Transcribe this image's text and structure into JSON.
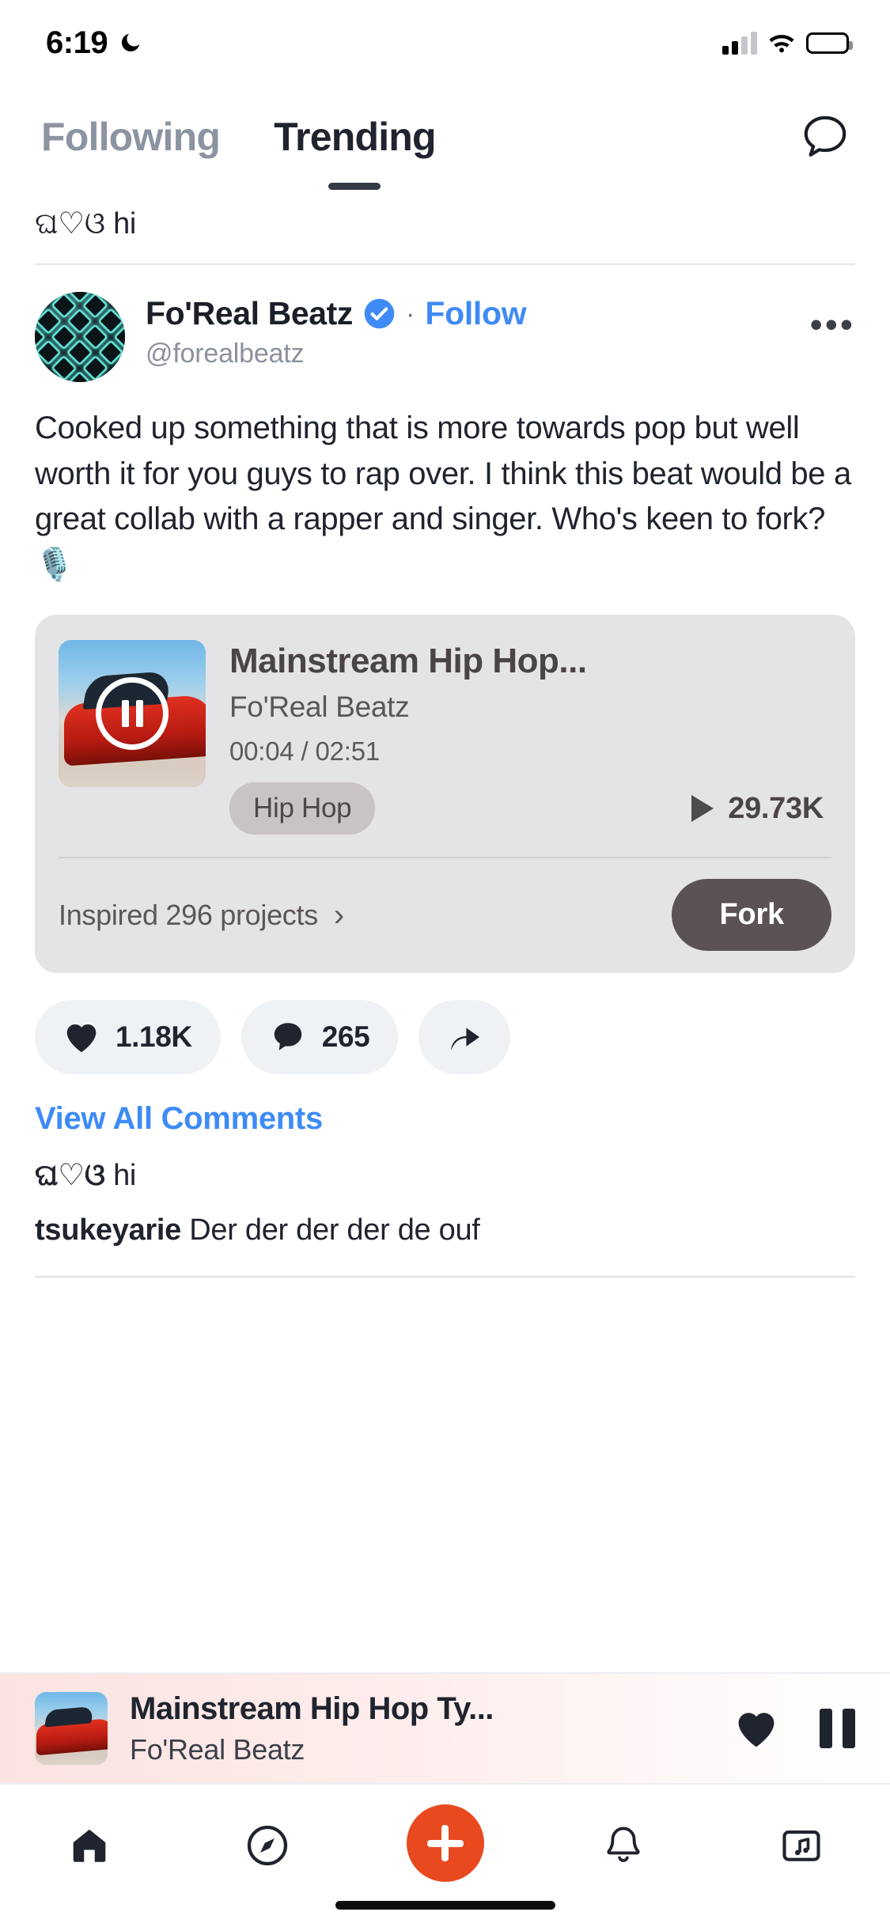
{
  "status_bar": {
    "time": "6:19",
    "dnd_icon": "moon-icon",
    "signal_icon": "cellular-signal-icon",
    "wifi_icon": "wifi-icon",
    "battery_icon": "battery-icon"
  },
  "header": {
    "tabs": [
      {
        "label": "Following",
        "active": false
      },
      {
        "label": "Trending",
        "active": true
      }
    ],
    "messages_icon": "chat-bubble-icon"
  },
  "previous_post_comment": {
    "user": "ଘ♡ଓ",
    "text": "hi"
  },
  "post": {
    "author": {
      "display_name": "Fo'Real Beatz",
      "handle": "@forealbeatz",
      "verified_icon": "verified-badge-icon",
      "separator": "·",
      "follow_label": "Follow",
      "more_label": "•••",
      "avatar_alt": "drum-pad-grid-avatar"
    },
    "body": "Cooked up something that is more towards pop but well worth it for you guys to rap over. I think this beat would be a great collab with a rapper and singer. Who's keen to fork? 🎙️",
    "media": {
      "title": "Mainstream Hip Hop...",
      "artist": "Fo'Real Beatz",
      "elapsed": "00:04",
      "duration": "02:51",
      "time_display": "00:04 / 02:51",
      "genre": "Hip Hop",
      "plays": "29.73K",
      "play_icon": "play-triangle-icon",
      "pause_icon": "pause-icon",
      "thumbnail_alt": "red-muscle-car-burnout-artwork",
      "inspired_label": "Inspired 296 projects",
      "inspired_chevron": "chevron-right-icon",
      "fork_label": "Fork"
    },
    "actions": {
      "like_count": "1.18K",
      "like_icon": "heart-icon",
      "comment_count": "265",
      "comment_icon": "comment-bubble-icon",
      "share_icon": "share-arrow-icon"
    },
    "comments": {
      "view_all_label": "View All Comments",
      "items": [
        {
          "user": "ଘ♡ଓ",
          "text": "hi",
          "script": "unicode"
        },
        {
          "user": "tsukeyarie",
          "text": "Der der der der de ouf",
          "script": "latin"
        }
      ]
    }
  },
  "mini_player": {
    "title": "Mainstream Hip Hop Ty...",
    "artist": "Fo'Real Beatz",
    "like_icon": "heart-filled-icon",
    "pause_icon": "pause-icon",
    "thumbnail_alt": "red-muscle-car-burnout-artwork"
  },
  "nav_bar": {
    "items": [
      {
        "icon": "home-icon",
        "label": "Home"
      },
      {
        "icon": "compass-icon",
        "label": "Discover"
      },
      {
        "icon": "plus-icon",
        "label": "Create"
      },
      {
        "icon": "bell-icon",
        "label": "Notifications"
      },
      {
        "icon": "folder-music-icon",
        "label": "Library"
      }
    ],
    "create_accent_color": "#e8491f"
  },
  "colors": {
    "accent_blue": "#3f8bf5",
    "accent_orange": "#e8491f",
    "text_primary": "#1f242e",
    "text_muted": "#8b919d",
    "card_bg": "#e4e4e6",
    "fork_btn": "#5b5257"
  }
}
